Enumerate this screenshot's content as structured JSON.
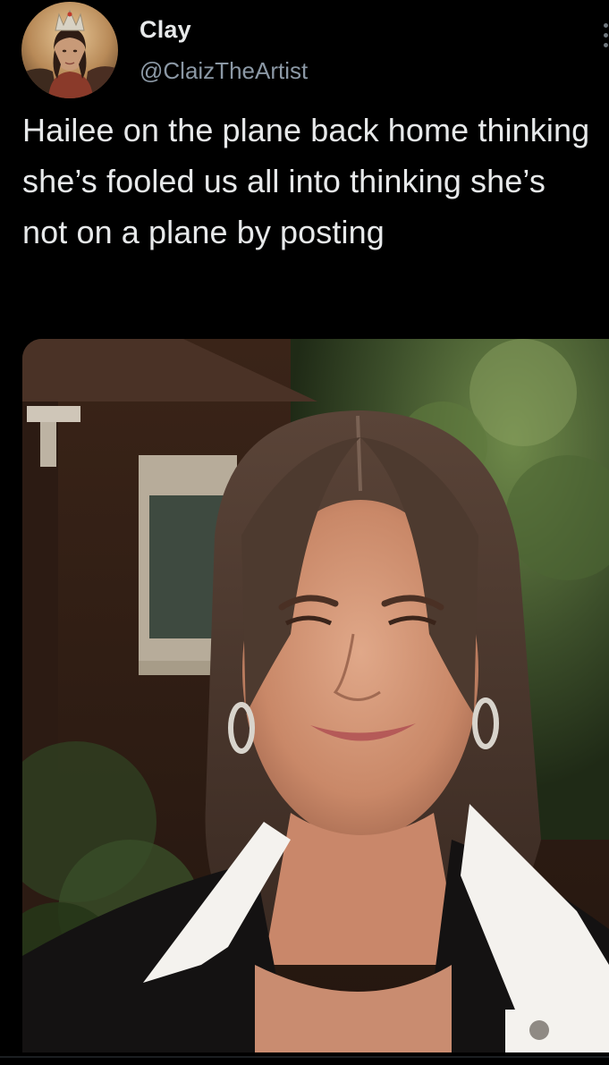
{
  "tweet": {
    "author": {
      "display_name": "Clay",
      "handle": "@ClaizTheArtist",
      "avatar_icon": "avatar-crowned-portrait"
    },
    "more_icon": "more-options-icon",
    "text": "Hailee on the plane back home thinking she’s fooled us all into thinking she’s not on a plane by posting",
    "media": {
      "type": "photo"
    }
  },
  "colors": {
    "background": "#000000",
    "primary_text": "#e7e9ea",
    "secondary_text": "#8b98a5"
  }
}
